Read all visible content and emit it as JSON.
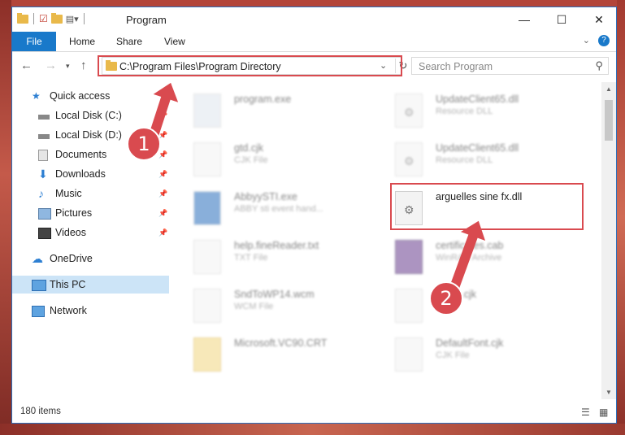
{
  "window": {
    "title": "Program",
    "minimize": "—",
    "maximize": "☐",
    "close": "✕"
  },
  "ribbon": {
    "tabs": [
      "File",
      "Home",
      "Share",
      "View"
    ]
  },
  "nav": {
    "address": "C:\\Program Files\\Program Directory",
    "search_placeholder": "Search Program"
  },
  "sidebar": {
    "items": [
      {
        "label": "Quick access",
        "icon": "star-icon",
        "pinned": false
      },
      {
        "label": "Local Disk (C:)",
        "icon": "drive-icon",
        "pinned": true
      },
      {
        "label": "Local Disk (D:)",
        "icon": "drive-icon",
        "pinned": true
      },
      {
        "label": "Documents",
        "icon": "documents-icon",
        "pinned": true
      },
      {
        "label": "Downloads",
        "icon": "download-icon",
        "pinned": true
      },
      {
        "label": "Music",
        "icon": "music-icon",
        "pinned": true
      },
      {
        "label": "Pictures",
        "icon": "pictures-icon",
        "pinned": true
      },
      {
        "label": "Videos",
        "icon": "videos-icon",
        "pinned": true
      },
      {
        "label": "OneDrive",
        "icon": "cloud-icon",
        "pinned": false
      },
      {
        "label": "This PC",
        "icon": "computer-icon",
        "pinned": false
      },
      {
        "label": "Network",
        "icon": "network-icon",
        "pinned": false
      }
    ]
  },
  "files": {
    "left": [
      {
        "name": "program.exe",
        "type": ""
      },
      {
        "name": "gtd.cjk",
        "type": "CJK File"
      },
      {
        "name": "AbbyySTI.exe",
        "type": "ABBY sti event hand..."
      },
      {
        "name": "help.fineReader.txt",
        "type": "TXT File"
      },
      {
        "name": "SndToWP14.wcm",
        "type": "WCM File"
      },
      {
        "name": "Microsoft.VC90.CRT",
        "type": ""
      }
    ],
    "right": [
      {
        "name": "UpdateClient65.dll",
        "type": "Resource DLL"
      },
      {
        "name": "UpdateClient65.dll",
        "type": "Resource DLL"
      },
      {
        "name": "arguelles sine fx.dll",
        "type": ""
      },
      {
        "name": "certificates.cab",
        "type": "WinRAR Archive"
      },
      {
        "name": "beam.cjk",
        "type": ""
      },
      {
        "name": "DefaultFont.cjk",
        "type": "CJK File"
      }
    ]
  },
  "status": {
    "items_count": "180 items"
  },
  "callouts": {
    "step1": "1",
    "step2": "2"
  },
  "colors": {
    "accent": "#1979ca",
    "highlight": "#d94a4f",
    "selected": "#cce4f7"
  }
}
